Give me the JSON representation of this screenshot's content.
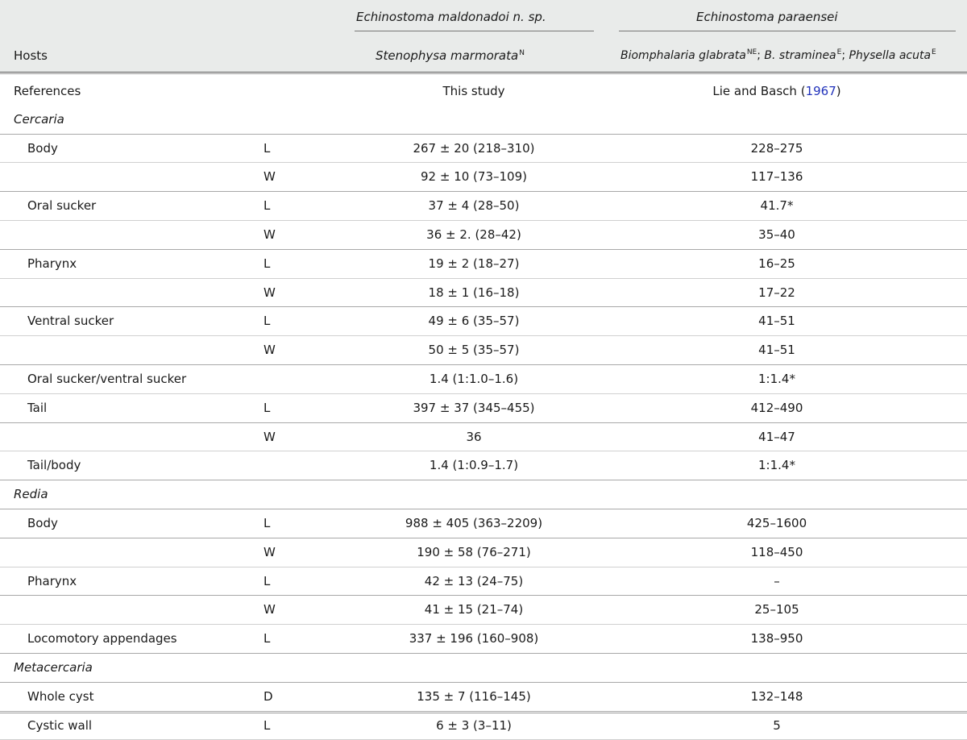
{
  "header": {
    "hosts_label": "Hosts",
    "col_a": {
      "species": "Echinostoma maldonadoi n. sp.",
      "host": "Stenophysa marmorata",
      "host_sup": "N"
    },
    "col_b": {
      "species": "Echinostoma paraensei",
      "host1": "Biomphalaria glabrata",
      "host1_sup": "NE",
      "sep1": "; ",
      "host2": "B. straminea",
      "host2_sup": "E",
      "sep2": "; ",
      "host3": "Physella acuta",
      "host3_sup": "E"
    }
  },
  "references": {
    "label": "References",
    "col_a": "This study",
    "col_b_pre": "Lie and Basch (",
    "col_b_year": "1967",
    "col_b_post": ")"
  },
  "rows": [
    {
      "label": "Cercaria",
      "section": true
    },
    {
      "label": "Body",
      "dim": "L",
      "a": "267 ± 20 (218–310)",
      "b": "228–275"
    },
    {
      "label": "",
      "dim": "W",
      "a": "92 ± 10 (73–109)",
      "b": "117–136"
    },
    {
      "label": "Oral sucker",
      "dim": "L",
      "a": "37 ± 4 (28–50)",
      "b": "41.7*"
    },
    {
      "label": "",
      "dim": "W",
      "a": "36 ± 2. (28–42)",
      "b": "35–40"
    },
    {
      "label": "Pharynx",
      "dim": "L",
      "a": "19 ± 2 (18–27)",
      "b": "16–25"
    },
    {
      "label": "",
      "dim": "W",
      "a": "18 ± 1 (16–18)",
      "b": "17–22"
    },
    {
      "label": "Ventral sucker",
      "dim": "L",
      "a": "49 ± 6 (35–57)",
      "b": "41–51"
    },
    {
      "label": "",
      "dim": "W",
      "a": "50 ± 5 (35–57)",
      "b": "41–51"
    },
    {
      "label": "Oral sucker/ventral sucker",
      "dim": "",
      "a": "1.4 (1:1.0–1.6)",
      "b": "1:1.4*"
    },
    {
      "label": "Tail",
      "dim": "L",
      "a": "397 ± 37 (345–455)",
      "b": "412–490"
    },
    {
      "label": "",
      "dim": "W",
      "a": "36",
      "b": "41–47"
    },
    {
      "label": "Tail/body",
      "dim": "",
      "a": "1.4 (1:0.9–1.7)",
      "b": "1:1.4*"
    },
    {
      "label": "Redia",
      "section": true
    },
    {
      "label": "Body",
      "dim": "L",
      "a": "988 ± 405 (363–2209)",
      "b": "425–1600"
    },
    {
      "label": "",
      "dim": "W",
      "a": "190 ± 58 (76–271)",
      "b": "118–450"
    },
    {
      "label": "Pharynx",
      "dim": "L",
      "a": "42 ± 13 (24–75)",
      "b": "–"
    },
    {
      "label": "",
      "dim": "W",
      "a": "41 ± 15 (21–74)",
      "b": "25–105"
    },
    {
      "label": "Locomotory appendages",
      "dim": "L",
      "a": "337 ± 196 (160–908)",
      "b": "138–950"
    },
    {
      "label": "Metacercaria",
      "section": true
    },
    {
      "label": "Whole cyst",
      "dim": "D",
      "a": "135 ± 7 (116–145)",
      "b": "132–148"
    },
    {
      "label": "Cystic wall",
      "dim": "L",
      "a": "6 ± 3 (3–11)",
      "b": "5"
    }
  ]
}
